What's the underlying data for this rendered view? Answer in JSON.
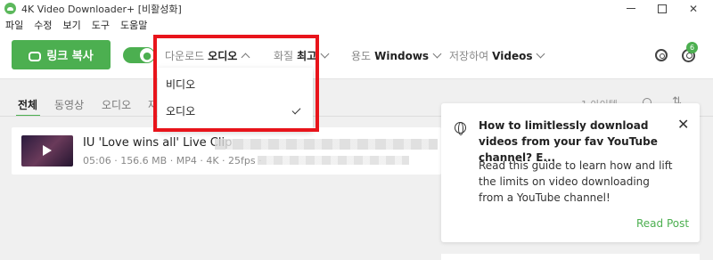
{
  "window": {
    "title": "4K Video Downloader+ [비활성화]",
    "minimize": "–",
    "maximize": "□",
    "close": "✕"
  },
  "menu": [
    "파일",
    "수정",
    "보기",
    "도구",
    "도움말"
  ],
  "toolbar": {
    "paste_label": "링크 복사",
    "format": {
      "label": "다운로드",
      "value": "오디오"
    },
    "quality": {
      "label": "화질",
      "value": "최고"
    },
    "usage": {
      "label": "용도",
      "value": "Windows"
    },
    "save": {
      "label": "저장하여",
      "value": "Videos"
    },
    "notifications": "6"
  },
  "tabs": {
    "all": "전체",
    "video": "동영상",
    "audio": "오디오",
    "more": "재",
    "count": "1 아이템"
  },
  "dropdown": {
    "items": [
      "비디오",
      "오디오"
    ],
    "selected": "오디오"
  },
  "download": {
    "title": "IU 'Love wins all' Live Clip",
    "meta": "05:06 · 156.6 MB · MP4 · 4K · 25fps ·"
  },
  "tip": {
    "title": "How to limitlessly download videos from your fav YouTube channel? E...",
    "body": "Read this guide to learn how and lift the limits on video downloading from a YouTube channel!",
    "link": "Read Post",
    "close": "✕"
  },
  "colors": {
    "accent": "#4caf50",
    "highlight": "#e8141b"
  }
}
